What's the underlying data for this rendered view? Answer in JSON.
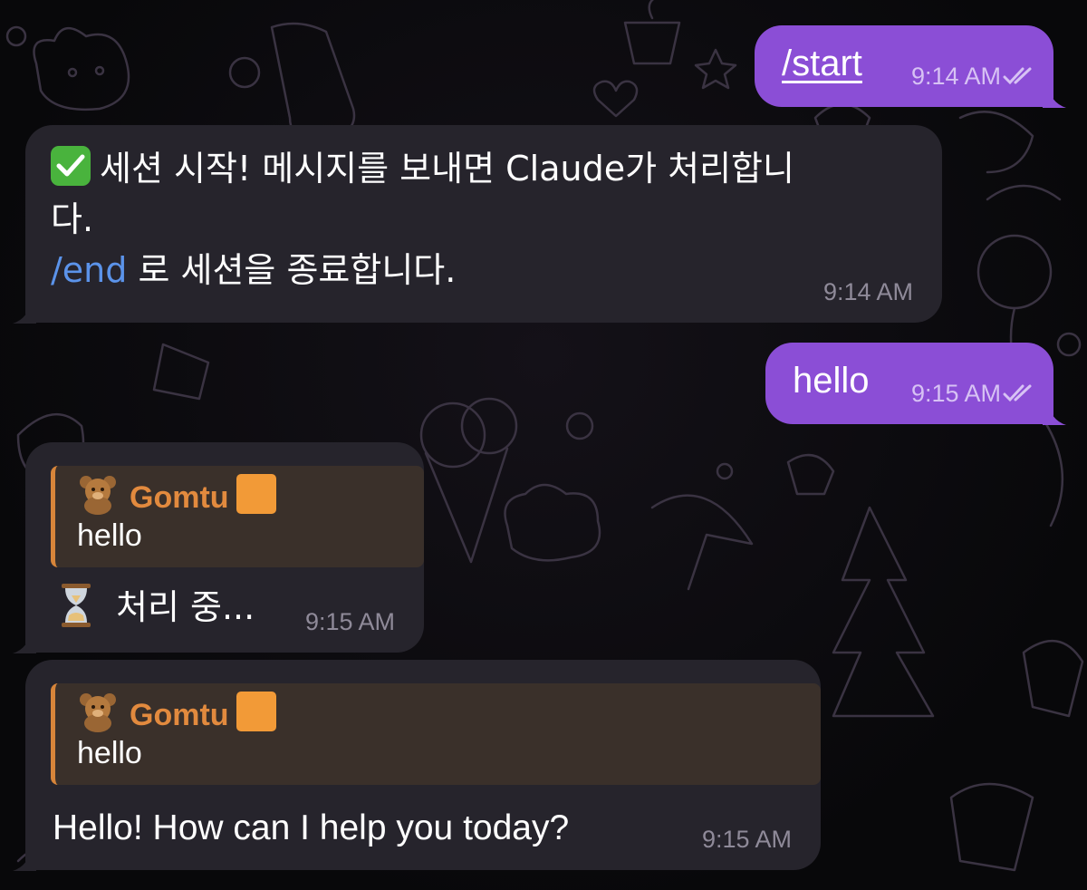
{
  "messages": [
    {
      "id": "m1",
      "direction": "outgoing",
      "text": "/start",
      "time": "9:14 AM",
      "status": "read"
    },
    {
      "id": "m2",
      "direction": "incoming",
      "icon": "check-mark-emoji",
      "line1": "세션 시작! 메시지를 보내면 Claude가 처리합니",
      "line2": "다.",
      "command": "/end",
      "line3_rest": " 로 세션을 종료합니다.",
      "time": "9:14 AM"
    },
    {
      "id": "m3",
      "direction": "outgoing",
      "text": "hello",
      "time": "9:15 AM",
      "status": "read"
    },
    {
      "id": "m4",
      "direction": "incoming",
      "reply": {
        "author": "Gomtu",
        "author_icon": "teddy-bear-emoji",
        "badge_color": "#f29a37",
        "text": "hello"
      },
      "icon": "hourglass-emoji",
      "text": "처리 중...",
      "time": "9:15 AM"
    },
    {
      "id": "m5",
      "direction": "incoming",
      "reply": {
        "author": "Gomtu",
        "author_icon": "teddy-bear-emoji",
        "badge_color": "#f29a37",
        "text": "hello"
      },
      "text": "Hello! How can I help you today?",
      "time": "9:15 AM"
    }
  ],
  "colors": {
    "outgoing_bubble": "#8b4ed6",
    "incoming_bubble": "#26242c",
    "link_blue": "#5b93ea",
    "reply_accent": "#d7853a",
    "reply_name": "#e28a3e"
  }
}
